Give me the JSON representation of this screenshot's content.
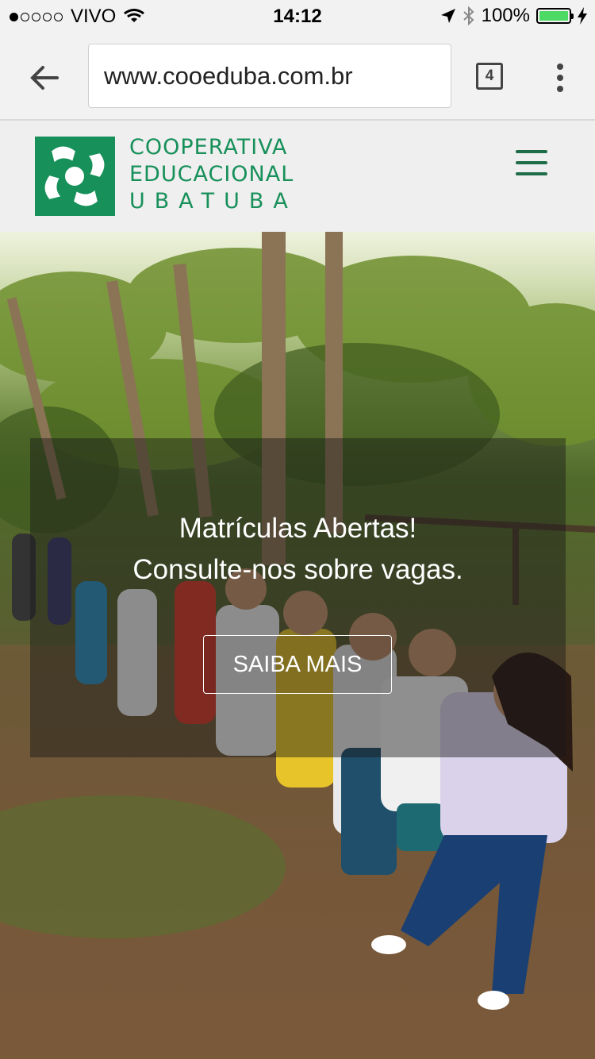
{
  "status_bar": {
    "carrier": "VIVO",
    "time": "14:12",
    "battery": "100%"
  },
  "browser": {
    "url": "www.cooeduba.com.br",
    "tab_count": "4"
  },
  "site": {
    "logo_lines": [
      "COOPERATIVA",
      "EDUCACIONAL",
      "UBATUBA"
    ],
    "brand_color": "#17905a"
  },
  "hero": {
    "headline_line1": "Matrículas Abertas!",
    "headline_line2": "Consulte-nos sobre vagas.",
    "cta_label": "SAIBA MAIS"
  },
  "icons": [
    "signal-dots-icon",
    "wifi-icon",
    "location-arrow-icon",
    "bluetooth-icon",
    "battery-icon",
    "back-arrow-icon",
    "tabs-icon",
    "more-vert-icon",
    "hamburger-menu-icon",
    "logo-hands-icon"
  ]
}
